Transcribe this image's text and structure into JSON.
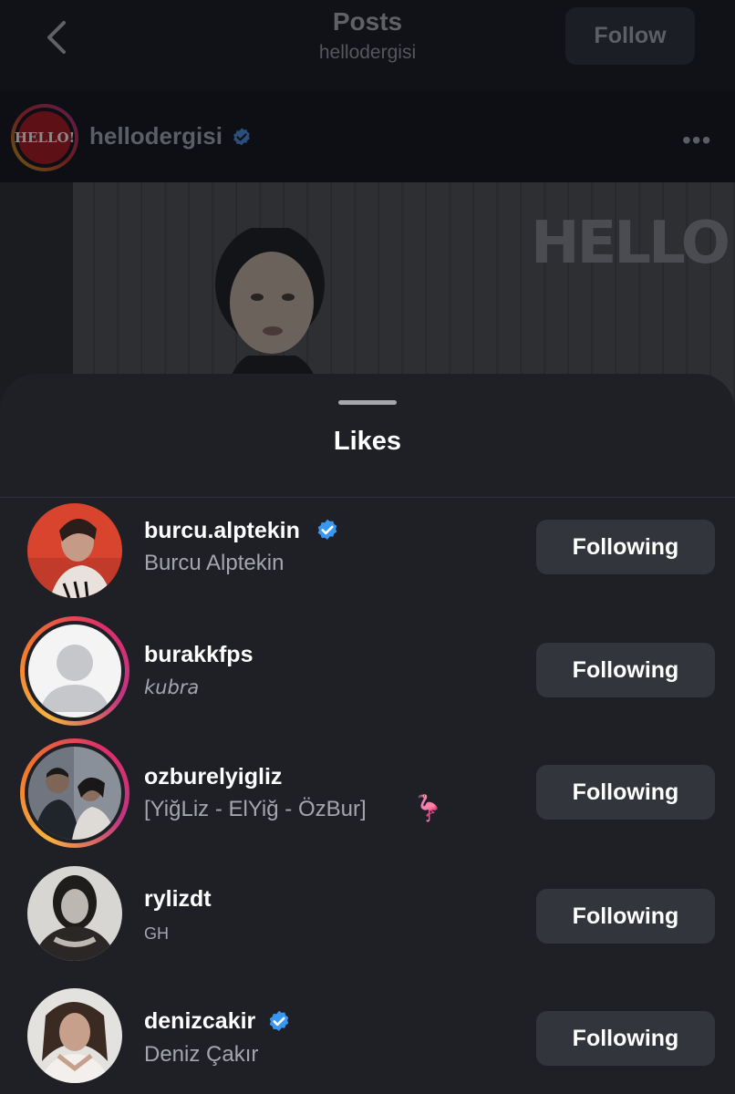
{
  "header": {
    "title": "Posts",
    "subtitle": "hellodergisi",
    "follow_label": "Follow"
  },
  "post": {
    "author": "hellodergisi",
    "avatar_text": "HELLO!",
    "image_brand": "HELLO!",
    "more_label": "•••"
  },
  "sheet": {
    "title": "Likes"
  },
  "likes": [
    {
      "username": "burcu.alptekin",
      "full_name": "Burcu Alptekin",
      "verified": true,
      "story_ring": false,
      "button_label": "Following"
    },
    {
      "username": "burakkfps",
      "full_name": "kubra",
      "verified": false,
      "story_ring": true,
      "button_label": "Following"
    },
    {
      "username": "ozburelyigliz",
      "full_name": "[YiğLiz - ElYiğ - ÖzBur]",
      "emoji": "🦩",
      "verified": false,
      "story_ring": true,
      "button_label": "Following"
    },
    {
      "username": "rylizdt",
      "full_name": "GH",
      "verified": false,
      "story_ring": false,
      "button_label": "Following"
    },
    {
      "username": "denizcakir",
      "full_name": "Deniz Çakır",
      "verified": true,
      "story_ring": false,
      "button_label": "Following"
    }
  ],
  "colors": {
    "sheet_bg": "#1f2026",
    "button_bg": "#33353c",
    "verified_blue": "#3897f0",
    "story_ring": [
      "#f8b13c",
      "#e02f6a",
      "#c13584"
    ]
  }
}
